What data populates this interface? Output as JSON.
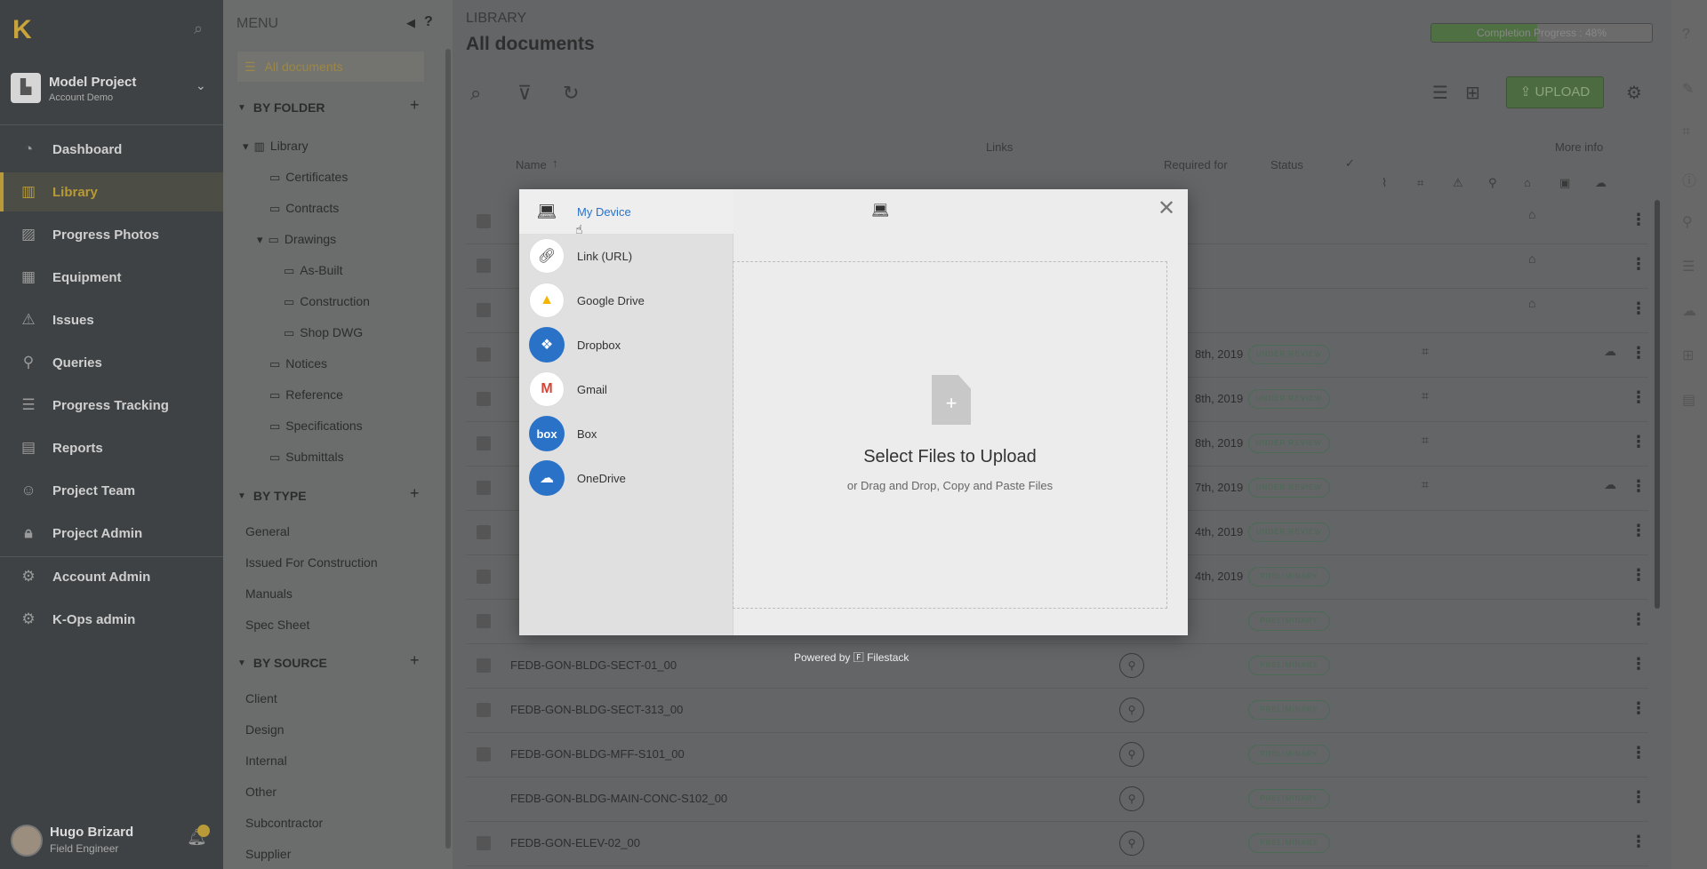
{
  "leftnav": {
    "project_name": "Model Project",
    "project_account": "Account Demo",
    "items": [
      {
        "label": "Dashboard",
        "icon": "dashboard-icon"
      },
      {
        "label": "Library",
        "icon": "library-icon"
      },
      {
        "label": "Progress Photos",
        "icon": "photos-icon"
      },
      {
        "label": "Equipment",
        "icon": "barcode-icon"
      },
      {
        "label": "Issues",
        "icon": "warning-icon"
      },
      {
        "label": "Queries",
        "icon": "location-pin-icon"
      },
      {
        "label": "Progress Tracking",
        "icon": "tracking-icon"
      },
      {
        "label": "Reports",
        "icon": "reports-icon"
      },
      {
        "label": "Project Team",
        "icon": "team-icon"
      },
      {
        "label": "Project Admin",
        "icon": "lock-icon"
      },
      {
        "label": "Account Admin",
        "icon": "gears-icon"
      },
      {
        "label": "K-Ops admin",
        "icon": "ops-icon"
      }
    ],
    "user_name": "Hugo Brizard",
    "user_role": "Field Engineer"
  },
  "menu": {
    "title": "MENU",
    "all_documents": "All documents",
    "by_folder": "BY FOLDER",
    "folders": {
      "library": "Library",
      "certificates": "Certificates",
      "contracts": "Contracts",
      "drawings": "Drawings",
      "as_built": "As-Built",
      "construction": "Construction",
      "shop_dwg": "Shop DWG",
      "notices": "Notices",
      "reference": "Reference",
      "specifications": "Specifications",
      "submittals": "Submittals"
    },
    "by_type": "BY TYPE",
    "types": [
      "General",
      "Issued For Construction",
      "Manuals",
      "Spec Sheet"
    ],
    "by_source": "BY SOURCE",
    "sources": [
      "Client",
      "Design",
      "Internal",
      "Other",
      "Subcontractor",
      "Supplier"
    ]
  },
  "main": {
    "breadcrumb": "LIBRARY",
    "title": "All documents",
    "progress_label": "Completion Progress : 48%",
    "progress_value": 0.48,
    "upload_label": "UPLOAD",
    "headers": {
      "name": "Name",
      "required_for": "Required for",
      "status": "Status",
      "links": "Links",
      "more_info": "More info"
    },
    "rows": [
      {
        "name": "",
        "date": "",
        "status": ""
      },
      {
        "name": "",
        "date": "",
        "status": ""
      },
      {
        "name": "",
        "date": "",
        "status": ""
      },
      {
        "name": "",
        "date": "8th, 2019",
        "status": "UNDER REVIEW"
      },
      {
        "name": "",
        "date": "8th, 2019",
        "status": "UNDER REVIEW"
      },
      {
        "name": "",
        "date": "8th, 2019",
        "status": "UNDER REVIEW"
      },
      {
        "name": "",
        "date": "7th, 2019",
        "status": "UNDER REVIEW"
      },
      {
        "name": "",
        "date": "4th, 2019",
        "status": "UNDER REVIEW"
      },
      {
        "name": "",
        "date": "4th, 2019",
        "status": "PRELIMINARY"
      },
      {
        "name": "",
        "date": "",
        "status": "PRELIMINARY"
      },
      {
        "name": "FEDB-GON-BLDG-SECT-01_00",
        "date": "",
        "status": "PRELIMINARY"
      },
      {
        "name": "FEDB-GON-BLDG-SECT-313_00",
        "date": "",
        "status": "PRELIMINARY"
      },
      {
        "name": "FEDB-GON-BLDG-MFF-S101_00",
        "date": "",
        "status": "PRELIMINARY"
      },
      {
        "name": "FEDB-GON-BLDG-MAIN-CONC-S102_00",
        "date": "",
        "status": "PRELIMINARY"
      },
      {
        "name": "FEDB-GON-ELEV-02_00",
        "date": "",
        "status": "PRELIMINARY"
      }
    ]
  },
  "modal": {
    "sources": [
      {
        "label": "My Device",
        "icon": "laptop-icon"
      },
      {
        "label": "Link (URL)",
        "icon": "link-icon"
      },
      {
        "label": "Google Drive",
        "icon": "google-drive-icon"
      },
      {
        "label": "Dropbox",
        "icon": "dropbox-icon"
      },
      {
        "label": "Gmail",
        "icon": "gmail-icon"
      },
      {
        "label": "Box",
        "icon": "box-icon"
      },
      {
        "label": "OneDrive",
        "icon": "onedrive-icon"
      }
    ],
    "dropzone_title": "Select Files to Upload",
    "dropzone_subtitle": "or Drag and Drop, Copy and Paste Files",
    "powered_by": "Powered by",
    "powered_brand": "Filestack",
    "box_glyph": "box"
  },
  "colors": {
    "accent": "#b99a38",
    "link_blue": "#2a72c8",
    "upload_green": "#4c6b41"
  }
}
